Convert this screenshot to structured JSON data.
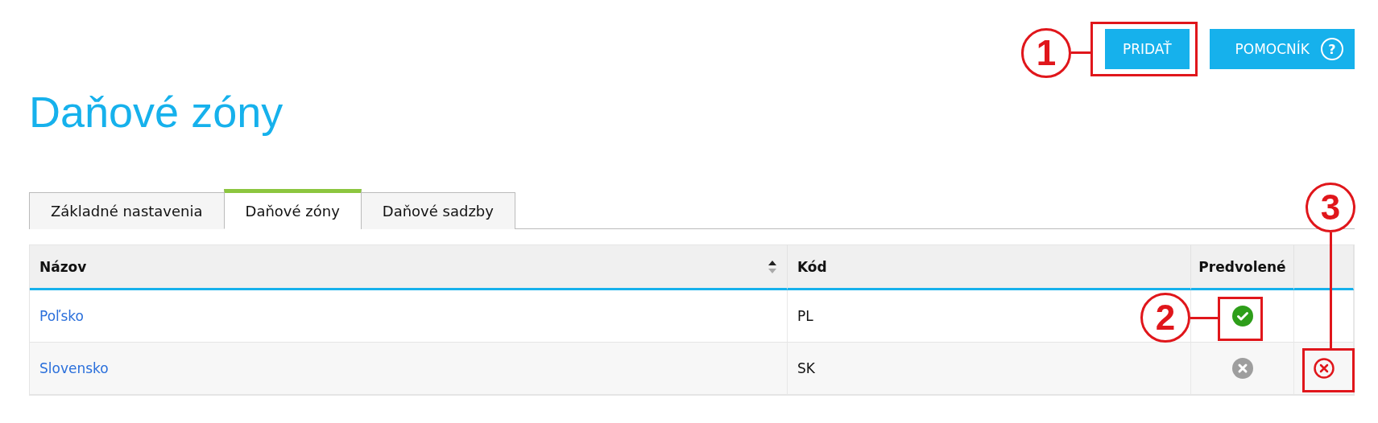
{
  "toolbar": {
    "buttons": [
      {
        "label": "PRIDAŤ",
        "kind": "plain"
      },
      {
        "label": "POMOCNÍK",
        "kind": "help",
        "icon": "?"
      }
    ]
  },
  "title": "Daňové zóny",
  "tabs": [
    {
      "label": "Základné nastavenia",
      "selected": false
    },
    {
      "label": "Daňové zóny",
      "selected": true
    },
    {
      "label": "Daňové sadzby",
      "selected": false
    }
  ],
  "table": {
    "columns": [
      {
        "label": "Názov",
        "sortable": true
      },
      {
        "label": "Kód"
      },
      {
        "label": "Predvolené"
      }
    ],
    "rows": [
      {
        "name": "Poľsko",
        "code": "PL",
        "default": true,
        "deletable": false
      },
      {
        "name": "Slovensko",
        "code": "SK",
        "default": false,
        "deletable": true
      }
    ]
  },
  "annotations": [
    {
      "number": "1"
    },
    {
      "number": "2"
    },
    {
      "number": "3"
    }
  ]
}
